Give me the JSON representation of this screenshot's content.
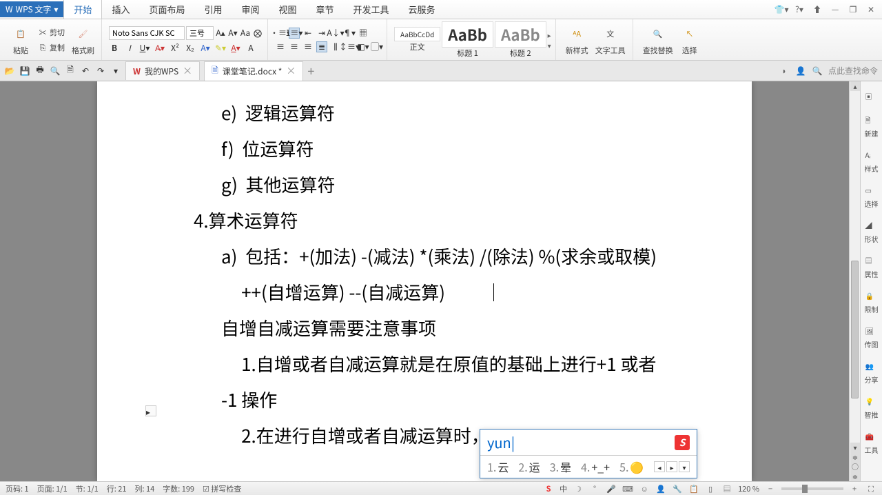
{
  "app": {
    "name": "WPS 文字"
  },
  "menu": {
    "items": [
      "开始",
      "插入",
      "页面布局",
      "引用",
      "审阅",
      "视图",
      "章节",
      "开发工具",
      "云服务"
    ],
    "active": 0
  },
  "ribbon": {
    "paste": "粘贴",
    "cut": "剪切",
    "copy": "复制",
    "format_painter": "格式刷",
    "font_name": "Noto Sans CJK SC",
    "font_size": "三号",
    "styles": {
      "s1": "AaBbCcDd",
      "s2": "AaBb",
      "s3": "AaBb",
      "l1": "正文",
      "l2": "标题 1",
      "l3": "标题 2"
    },
    "new_style": "新样式",
    "text_tools": "文字工具",
    "find_replace": "查找替换",
    "select": "选择"
  },
  "doctabs": {
    "tab1": "我的WPS",
    "tab2": "课堂笔记.docx *",
    "search_hint": "点此查找命令"
  },
  "document": {
    "lines": [
      "e)  逻辑运算符",
      "f)  位运算符",
      "g)  其他运算符",
      "4.算术运算符",
      "a)  包括：+(加法) -(减法) *(乘法) /(除法) %(求余或取模)",
      "     ++(自增运算) --(自减运算)",
      "自增自减运算需要注意事项",
      "     1.自增或者自减运算就是在原值的基础上进行+1 或者",
      "-1 操作",
      "     2.在进行自增或者自减运算时，"
    ]
  },
  "ime": {
    "input": "yun",
    "candidates": [
      {
        "n": "1.",
        "t": "云"
      },
      {
        "n": "2.",
        "t": "运"
      },
      {
        "n": "3.",
        "t": "晕"
      },
      {
        "n": "4.",
        "t": "+_+"
      },
      {
        "n": "5.",
        "t": "🟡"
      }
    ]
  },
  "sidebar": {
    "items": [
      "新建",
      "样式",
      "选择",
      "形状",
      "属性",
      "限制",
      "传图",
      "分享",
      "智推",
      "工具"
    ]
  },
  "status": {
    "page_no": "页码: 1",
    "page": "页面: 1/1",
    "section": "节: 1/1",
    "row": "行: 21",
    "col": "列: 14",
    "chars": "字数: 199",
    "spell": "拼写检查",
    "ime": "中",
    "zoom": "120 %"
  }
}
